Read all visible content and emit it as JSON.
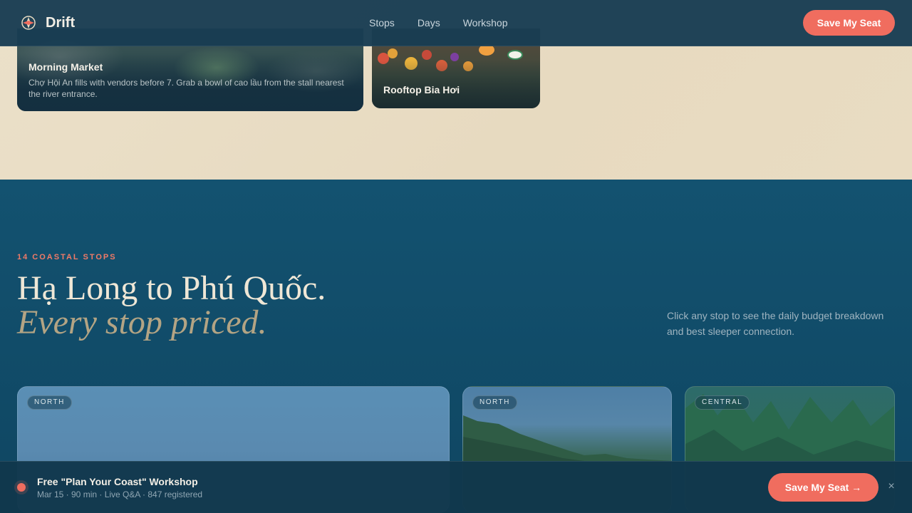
{
  "nav": {
    "brand": "Drift",
    "links": [
      "Stops",
      "Days",
      "Workshop"
    ],
    "cta": "Save My Seat"
  },
  "photo_cards": {
    "market": {
      "title": "Morning Market",
      "description": "Chợ Hội An fills with vendors before 7. Grab a bowl of cao lầu from the stall nearest the river entrance."
    },
    "rooftop": {
      "title": "Rooftop Bia Hơi"
    }
  },
  "stops_section": {
    "eyebrow": "14 COASTAL STOPS",
    "headline": "Hạ Long to Phú Quốc.",
    "headline_italic": "Every stop priced.",
    "side_note": "Click any stop to see the daily budget breakdown and best sleeper connection.",
    "cards": [
      {
        "region": "NORTH"
      },
      {
        "region": "NORTH"
      },
      {
        "region": "CENTRAL"
      }
    ]
  },
  "bottom_bar": {
    "title": "Free \"Plan Your Coast\" Workshop",
    "subtitle": "Mar 15 · 90 min · Live Q&A · 847 registered",
    "cta": "Save My Seat →",
    "close": "×"
  },
  "colors": {
    "accent": "#f06d5f",
    "teal": "#135270",
    "beige": "#e8dcc3",
    "cream": "#efe7d6",
    "gold": "#b3a484"
  }
}
